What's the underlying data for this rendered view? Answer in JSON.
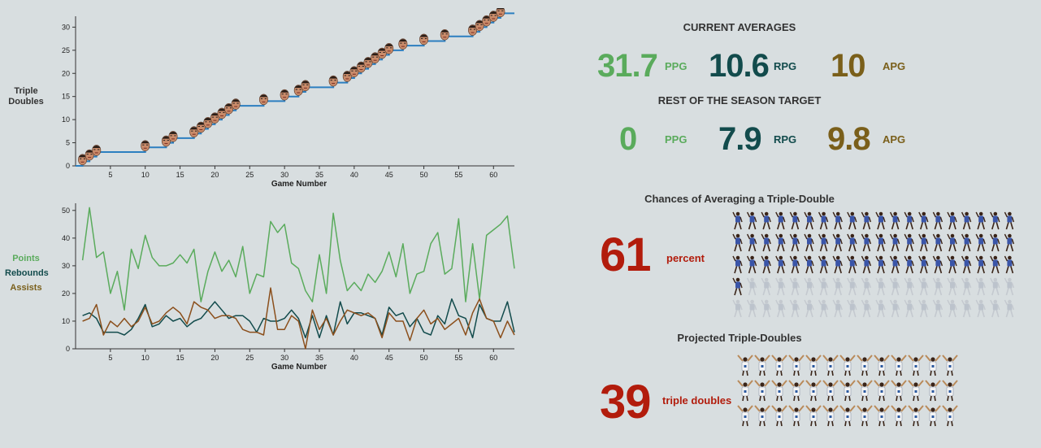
{
  "colors": {
    "background": "#d8dee0",
    "cumulative": "#2c7fc0",
    "points": "#5aab5c",
    "rebounds": "#124b4c",
    "assists": "#8b4f1c",
    "apg_text": "#7a5f1a",
    "percent_text": "#b21c0c",
    "axis": "#333333"
  },
  "left": {
    "top_ylabel_line1": "Triple",
    "top_ylabel_line2": "Doubles",
    "legend": {
      "points": "Points",
      "rebounds": "Rebounds",
      "assists": "Assists"
    }
  },
  "right": {
    "current_title": "CURRENT AVERAGES",
    "current": {
      "ppg": "31.7",
      "rpg": "10.6",
      "apg": "10",
      "ppg_unit": "PPG",
      "rpg_unit": "RPG",
      "apg_unit": "APG"
    },
    "target_title": "REST OF THE SEASON TARGET",
    "target": {
      "ppg": "0",
      "rpg": "7.9",
      "apg": "9.8",
      "ppg_unit": "PPG",
      "rpg_unit": "RPG",
      "apg_unit": "APG"
    },
    "chances_title": "Chances of Averaging a Triple-Double",
    "chances_value": "61",
    "chances_unit": "percent",
    "chances_icon": "player-figure-icon",
    "chances_filled": 61,
    "chances_total": 100,
    "projected_title": "Projected Triple-Doubles",
    "projected_value": "39",
    "projected_unit": "triple doubles",
    "projected_icon": "celebrating-player-icon",
    "projected_count": 39
  },
  "chart_data": [
    {
      "type": "line",
      "title": "",
      "xlabel": "Game Number",
      "ylabel": "Triple Doubles",
      "xlim": [
        0,
        63
      ],
      "ylim": [
        0,
        32
      ],
      "xticks": [
        5,
        10,
        15,
        20,
        25,
        30,
        35,
        40,
        45,
        50,
        55,
        60
      ],
      "yticks": [
        0,
        5,
        10,
        15,
        20,
        25,
        30
      ],
      "marker_icon": "player-face-icon",
      "triple_double_games": [
        1,
        2,
        3,
        10,
        13,
        14,
        17,
        18,
        19,
        20,
        21,
        22,
        23,
        27,
        30,
        32,
        33,
        37,
        39,
        40,
        41,
        42,
        43,
        44,
        45,
        47,
        50,
        53,
        57,
        58,
        59,
        60,
        61
      ],
      "series": [
        {
          "name": "Triple Doubles",
          "x_end": 63
        }
      ]
    },
    {
      "type": "line",
      "title": "",
      "xlabel": "Game Number",
      "ylabel": "",
      "xlim": [
        0,
        63
      ],
      "ylim": [
        0,
        52
      ],
      "xticks": [
        5,
        10,
        15,
        20,
        25,
        30,
        35,
        40,
        45,
        50,
        55,
        60
      ],
      "yticks": [
        0,
        10,
        20,
        30,
        40,
        50
      ],
      "x": [
        1,
        2,
        3,
        4,
        5,
        6,
        7,
        8,
        9,
        10,
        11,
        12,
        13,
        14,
        15,
        16,
        17,
        18,
        19,
        20,
        21,
        22,
        23,
        24,
        25,
        26,
        27,
        28,
        29,
        30,
        31,
        32,
        33,
        34,
        35,
        36,
        37,
        38,
        39,
        40,
        41,
        42,
        43,
        44,
        45,
        46,
        47,
        48,
        49,
        50,
        51,
        52,
        53,
        54,
        55,
        56,
        57,
        58,
        59,
        60,
        61,
        62,
        63
      ],
      "series": [
        {
          "name": "Points",
          "values": [
            32,
            51,
            33,
            35,
            20,
            28,
            14,
            36,
            29,
            41,
            33,
            30,
            30,
            31,
            34,
            31,
            36,
            17,
            28,
            35,
            28,
            32,
            26,
            37,
            20,
            27,
            26,
            46,
            42,
            45,
            31,
            29,
            21,
            17,
            34,
            20,
            49,
            32,
            21,
            24,
            21,
            27,
            24,
            28,
            35,
            26,
            38,
            20,
            27,
            28,
            38,
            42,
            27,
            29,
            47,
            17,
            38,
            18,
            41,
            43,
            45,
            48,
            29
          ]
        },
        {
          "name": "Rebounds",
          "values": [
            12,
            13,
            11,
            6,
            6,
            6,
            5,
            7,
            11,
            16,
            8,
            9,
            12,
            10,
            11,
            8,
            10,
            11,
            14,
            17,
            14,
            11,
            12,
            12,
            10,
            6,
            11,
            10,
            10,
            11,
            14,
            11,
            4,
            12,
            4,
            12,
            5,
            17,
            9,
            13,
            13,
            12,
            11,
            5,
            15,
            12,
            13,
            8,
            11,
            6,
            5,
            12,
            9,
            18,
            12,
            11,
            4,
            16,
            11,
            10,
            10,
            17,
            6
          ]
        },
        {
          "name": "Assists",
          "values": [
            10,
            11,
            16,
            5,
            10,
            8,
            11,
            8,
            10,
            15,
            9,
            10,
            13,
            15,
            13,
            9,
            17,
            15,
            14,
            11,
            12,
            12,
            11,
            7,
            6,
            6,
            5,
            22,
            7,
            7,
            12,
            10,
            0,
            14,
            7,
            11,
            5,
            10,
            14,
            13,
            12,
            13,
            11,
            4,
            13,
            10,
            10,
            3,
            11,
            14,
            9,
            11,
            7,
            9,
            11,
            5,
            13,
            18,
            11,
            10,
            4,
            10,
            5
          ]
        }
      ]
    }
  ]
}
